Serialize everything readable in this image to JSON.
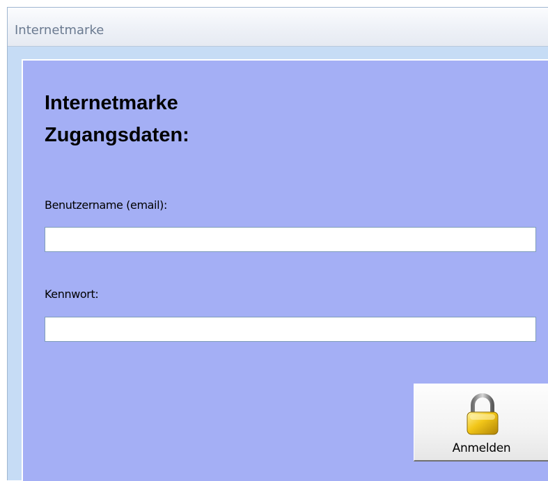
{
  "window": {
    "title": "Internetmarke"
  },
  "form": {
    "heading_line1": "Internetmarke",
    "heading_line2": "Zugangsdaten:",
    "username_label": "Benutzername (email):",
    "username_value": "",
    "password_label": "Kennwort:",
    "password_value": "",
    "login_button_label": "Anmelden",
    "login_button_icon": "lock-icon"
  },
  "colors": {
    "panel_background": "#a4aff5",
    "window_background": "#c6dcf5",
    "lock_body": "#f2c618"
  }
}
